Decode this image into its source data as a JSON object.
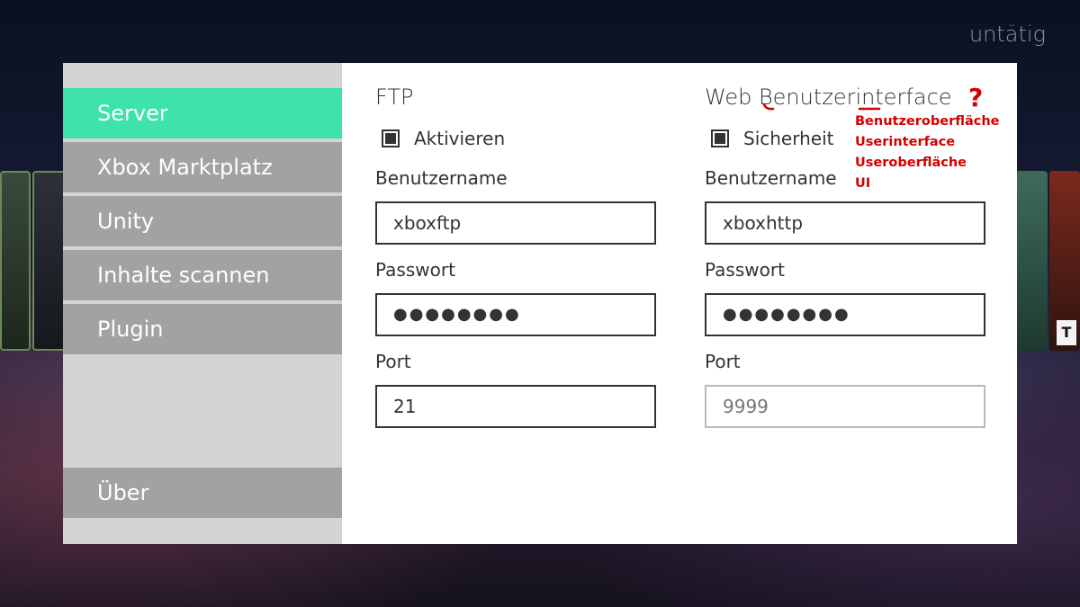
{
  "status": "untätig",
  "sidebar": {
    "items": [
      {
        "label": "Server"
      },
      {
        "label": "Xbox Marktplatz"
      },
      {
        "label": "Unity"
      },
      {
        "label": "Inhalte scannen"
      },
      {
        "label": "Plugin"
      }
    ],
    "footer_item": {
      "label": "Über"
    }
  },
  "ftp": {
    "title": "FTP",
    "enable_label": "Aktivieren",
    "enabled": true,
    "username_label": "Benutzername",
    "username": "xboxftp",
    "password_label": "Passwort",
    "password": "●●●●●●●●",
    "port_label": "Port",
    "port": "21"
  },
  "web": {
    "title": "Web Benutzerinterface",
    "security_label": "Sicherheit",
    "security_enabled": true,
    "username_label": "Benutzername",
    "username": "xboxhttp",
    "password_label": "Passwort",
    "password": "●●●●●●●●",
    "port_label": "Port",
    "port_placeholder": "9999"
  },
  "annotation": {
    "question_mark": "?",
    "suggestions": [
      "Benutzeroberfläche",
      "Userinterface",
      "Useroberfläche",
      "UI"
    ]
  },
  "background": {
    "rating_badge": "T"
  },
  "colors": {
    "active_nav": "#3de3a9",
    "nav_item": "#a2a2a2",
    "sidebar_bg": "#d4d4d4",
    "annotation": "#d40000"
  }
}
